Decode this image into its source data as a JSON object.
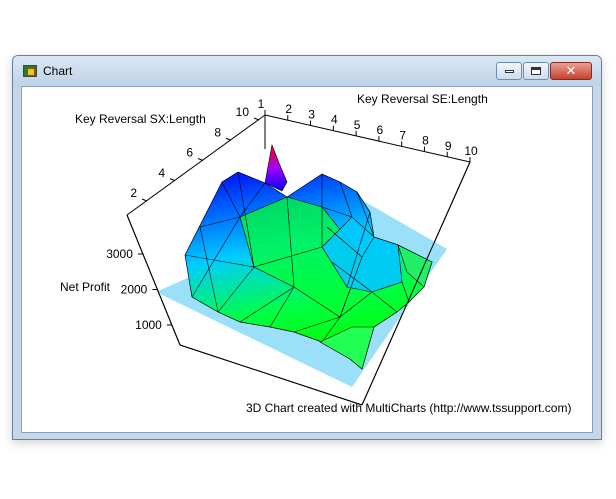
{
  "window": {
    "title": "Chart",
    "icon": "chart-app-icon",
    "buttons": {
      "minimize": "minimize-icon",
      "maximize": "maximize-icon",
      "close": "close-icon"
    }
  },
  "chart": {
    "footer": "3D Chart created with MultiCharts (http://www.tssupport.com)"
  },
  "chart_data": {
    "type": "surface",
    "xlabel": "Key Reversal SE:Length",
    "ylabel": "Key Reversal SX:Length",
    "zlabel": "Net Profit",
    "x_ticks": [
      "1",
      "2",
      "3",
      "4",
      "5",
      "6",
      "7",
      "8",
      "9",
      "10"
    ],
    "y_ticks": [
      "2",
      "4",
      "6",
      "8",
      "10"
    ],
    "z_ticks": [
      "1000",
      "2000",
      "3000"
    ],
    "colors": {
      "low": "#00ff00",
      "mid": "#00ccff",
      "high": "#0000ff",
      "peak": "#ff0000",
      "plane": "#80d8f6"
    }
  }
}
